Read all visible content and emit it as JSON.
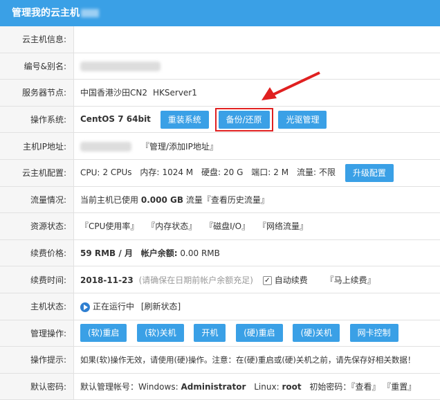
{
  "header": {
    "title": "管理我的云主机"
  },
  "rows": {
    "info": {
      "label": "云主机信息:"
    },
    "id": {
      "label": "编号&别名:"
    },
    "node": {
      "label": "服务器节点:",
      "location": "中国香港沙田CN2",
      "server": "HKServer1"
    },
    "os": {
      "label": "操作系统:",
      "value": "CentOS 7 64bit",
      "reinstall": "重装系统",
      "backup": "备份/还原",
      "cdrom": "光驱管理"
    },
    "ip": {
      "label": "主机IP地址:",
      "manage": "『管理/添加IP地址』"
    },
    "config": {
      "label": "云主机配置:",
      "cpu_label": "CPU:",
      "cpu": "2 CPUs",
      "mem_label": "内存:",
      "mem": "1024 M",
      "disk_label": "硬盘:",
      "disk": "20 G",
      "port_label": "端口:",
      "port": "2 M",
      "traffic_label": "流量:",
      "traffic": "不限",
      "upgrade": "升级配置"
    },
    "usage": {
      "label": "流量情况:",
      "prefix": "当前主机已使用",
      "amount": "0.000 GB",
      "suffix": "流量",
      "history": "『查看历史流量』"
    },
    "resource": {
      "label": "资源状态:",
      "cpu": "『CPU使用率』",
      "mem": "『内存状态』",
      "disk": "『磁盘I/O』",
      "net": "『网络流量』"
    },
    "price": {
      "label": "续费价格:",
      "value": "59 RMB / 月",
      "balance_label": "帐户余额:",
      "balance": "0.00 RMB"
    },
    "renew": {
      "label": "续费时间:",
      "date": "2018-11-23",
      "note": "(请确保在日期前帐户余额充足)",
      "auto": "自动续费",
      "now": "『马上续费』"
    },
    "status": {
      "label": "主机状态:",
      "state": "正在运行中",
      "refresh": "[刷新状态]"
    },
    "ops": {
      "label": "管理操作:",
      "buttons": [
        "(软)重启",
        "(软)关机",
        "开机",
        "(硬)重启",
        "(硬)关机",
        "网卡控制"
      ]
    },
    "tip": {
      "label": "操作提示:",
      "text": "如果(软)操作无效，请使用(硬)操作。注意：在(硬)重启或(硬)关机之前，请先保存好相关数据！"
    },
    "pwd": {
      "label": "默认密码:",
      "account_label": "默认管理帐号：Windows:",
      "windows": "Administrator",
      "linux_label": "Linux:",
      "linux": "root",
      "pwd_label": "初始密码：",
      "view": "『查看』",
      "reset": "『重置』"
    }
  }
}
